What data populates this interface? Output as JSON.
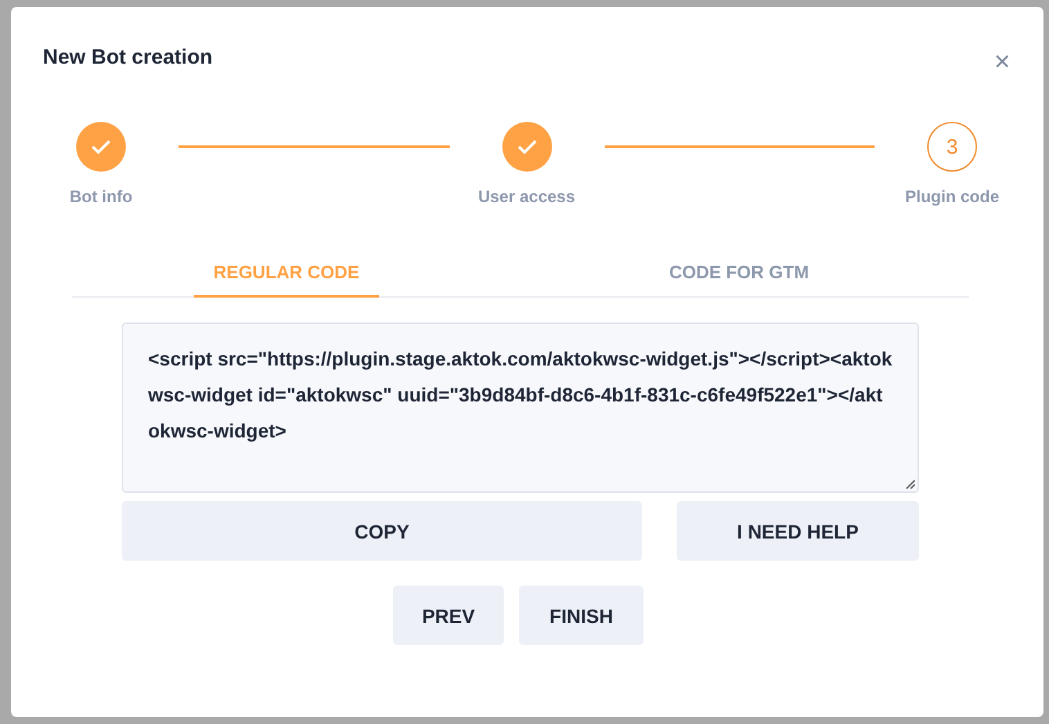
{
  "dialog": {
    "title": "New Bot creation",
    "close": "×"
  },
  "steps": [
    {
      "label": "Bot info",
      "done": true
    },
    {
      "label": "User access",
      "done": true
    },
    {
      "label": "Plugin code",
      "done": false,
      "number": "3"
    }
  ],
  "tabs": [
    {
      "label": "REGULAR CODE",
      "selected": true
    },
    {
      "label": "CODE FOR GTM",
      "selected": false
    }
  ],
  "code": "<script src=\"https://plugin.stage.aktok.com/aktokwsc-widget.js\"></script><aktokwsc-widget id=\"aktokwsc\" uuid=\"3b9d84bf-d8c6-4b1f-831c-c6fe49f522e1\"></aktokwsc-widget>",
  "actions": [
    "COPY",
    "I NEED HELP"
  ],
  "nav": [
    "PREV",
    "FINISH"
  ]
}
